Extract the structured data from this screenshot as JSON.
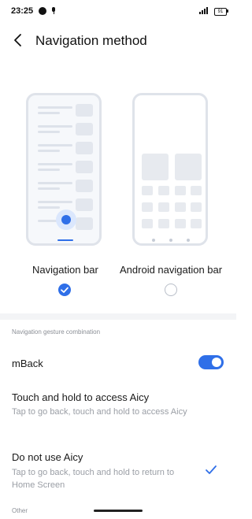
{
  "status_bar": {
    "time": "23:25",
    "battery": "91",
    "icons": [
      "status-dot-icon",
      "microphone-icon",
      "signal-icon",
      "battery-icon"
    ]
  },
  "header": {
    "title": "Navigation method",
    "back_icon": "back-arrow-icon"
  },
  "options": [
    {
      "label": "Navigation bar",
      "selected": true
    },
    {
      "label": "Android navigation bar",
      "selected": false
    }
  ],
  "gesture_section": {
    "header": "Navigation gesture combination",
    "rows": [
      {
        "title": "mBack",
        "toggle_on": true
      },
      {
        "title": "Touch and hold to access Aicy",
        "subtitle": "Tap to go back, touch and hold to access Aicy"
      },
      {
        "title": "Do not use Aicy",
        "subtitle": "Tap to go back, touch and hold to return to Home Screen",
        "checked": true
      }
    ]
  },
  "other_section": {
    "header": "Other"
  },
  "colors": {
    "accent": "#2f6fe8",
    "divider": "#f3f4f6"
  }
}
